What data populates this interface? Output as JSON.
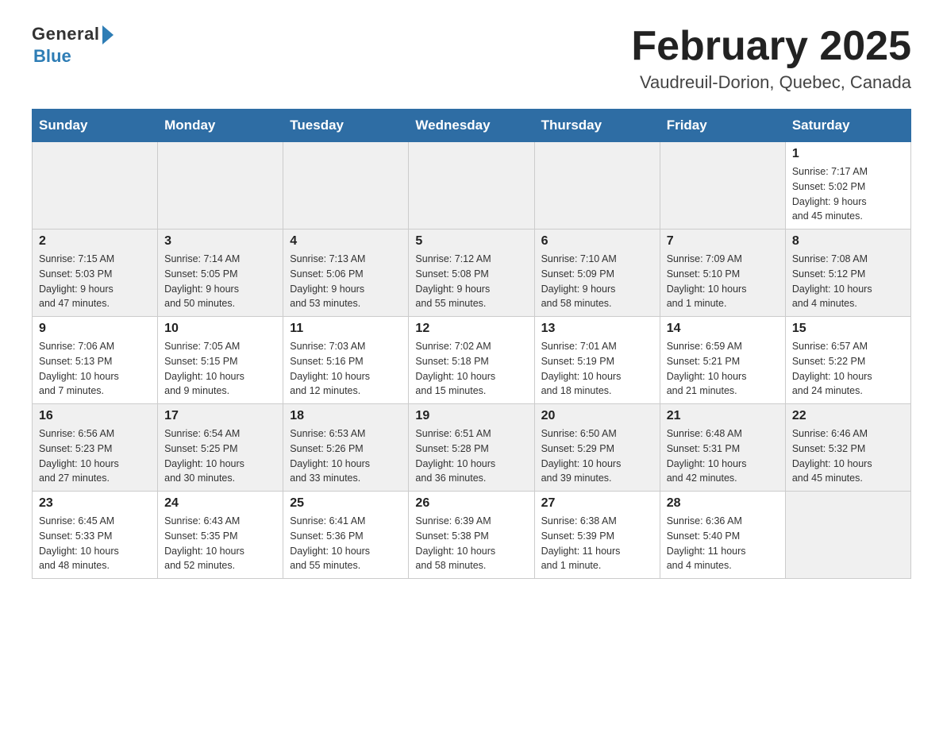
{
  "header": {
    "logo_general": "General",
    "logo_blue": "Blue",
    "page_title": "February 2025",
    "subtitle": "Vaudreuil-Dorion, Quebec, Canada"
  },
  "weekdays": [
    "Sunday",
    "Monday",
    "Tuesday",
    "Wednesday",
    "Thursday",
    "Friday",
    "Saturday"
  ],
  "weeks": [
    [
      {
        "day": "",
        "info": ""
      },
      {
        "day": "",
        "info": ""
      },
      {
        "day": "",
        "info": ""
      },
      {
        "day": "",
        "info": ""
      },
      {
        "day": "",
        "info": ""
      },
      {
        "day": "",
        "info": ""
      },
      {
        "day": "1",
        "info": "Sunrise: 7:17 AM\nSunset: 5:02 PM\nDaylight: 9 hours\nand 45 minutes."
      }
    ],
    [
      {
        "day": "2",
        "info": "Sunrise: 7:15 AM\nSunset: 5:03 PM\nDaylight: 9 hours\nand 47 minutes."
      },
      {
        "day": "3",
        "info": "Sunrise: 7:14 AM\nSunset: 5:05 PM\nDaylight: 9 hours\nand 50 minutes."
      },
      {
        "day": "4",
        "info": "Sunrise: 7:13 AM\nSunset: 5:06 PM\nDaylight: 9 hours\nand 53 minutes."
      },
      {
        "day": "5",
        "info": "Sunrise: 7:12 AM\nSunset: 5:08 PM\nDaylight: 9 hours\nand 55 minutes."
      },
      {
        "day": "6",
        "info": "Sunrise: 7:10 AM\nSunset: 5:09 PM\nDaylight: 9 hours\nand 58 minutes."
      },
      {
        "day": "7",
        "info": "Sunrise: 7:09 AM\nSunset: 5:10 PM\nDaylight: 10 hours\nand 1 minute."
      },
      {
        "day": "8",
        "info": "Sunrise: 7:08 AM\nSunset: 5:12 PM\nDaylight: 10 hours\nand 4 minutes."
      }
    ],
    [
      {
        "day": "9",
        "info": "Sunrise: 7:06 AM\nSunset: 5:13 PM\nDaylight: 10 hours\nand 7 minutes."
      },
      {
        "day": "10",
        "info": "Sunrise: 7:05 AM\nSunset: 5:15 PM\nDaylight: 10 hours\nand 9 minutes."
      },
      {
        "day": "11",
        "info": "Sunrise: 7:03 AM\nSunset: 5:16 PM\nDaylight: 10 hours\nand 12 minutes."
      },
      {
        "day": "12",
        "info": "Sunrise: 7:02 AM\nSunset: 5:18 PM\nDaylight: 10 hours\nand 15 minutes."
      },
      {
        "day": "13",
        "info": "Sunrise: 7:01 AM\nSunset: 5:19 PM\nDaylight: 10 hours\nand 18 minutes."
      },
      {
        "day": "14",
        "info": "Sunrise: 6:59 AM\nSunset: 5:21 PM\nDaylight: 10 hours\nand 21 minutes."
      },
      {
        "day": "15",
        "info": "Sunrise: 6:57 AM\nSunset: 5:22 PM\nDaylight: 10 hours\nand 24 minutes."
      }
    ],
    [
      {
        "day": "16",
        "info": "Sunrise: 6:56 AM\nSunset: 5:23 PM\nDaylight: 10 hours\nand 27 minutes."
      },
      {
        "day": "17",
        "info": "Sunrise: 6:54 AM\nSunset: 5:25 PM\nDaylight: 10 hours\nand 30 minutes."
      },
      {
        "day": "18",
        "info": "Sunrise: 6:53 AM\nSunset: 5:26 PM\nDaylight: 10 hours\nand 33 minutes."
      },
      {
        "day": "19",
        "info": "Sunrise: 6:51 AM\nSunset: 5:28 PM\nDaylight: 10 hours\nand 36 minutes."
      },
      {
        "day": "20",
        "info": "Sunrise: 6:50 AM\nSunset: 5:29 PM\nDaylight: 10 hours\nand 39 minutes."
      },
      {
        "day": "21",
        "info": "Sunrise: 6:48 AM\nSunset: 5:31 PM\nDaylight: 10 hours\nand 42 minutes."
      },
      {
        "day": "22",
        "info": "Sunrise: 6:46 AM\nSunset: 5:32 PM\nDaylight: 10 hours\nand 45 minutes."
      }
    ],
    [
      {
        "day": "23",
        "info": "Sunrise: 6:45 AM\nSunset: 5:33 PM\nDaylight: 10 hours\nand 48 minutes."
      },
      {
        "day": "24",
        "info": "Sunrise: 6:43 AM\nSunset: 5:35 PM\nDaylight: 10 hours\nand 52 minutes."
      },
      {
        "day": "25",
        "info": "Sunrise: 6:41 AM\nSunset: 5:36 PM\nDaylight: 10 hours\nand 55 minutes."
      },
      {
        "day": "26",
        "info": "Sunrise: 6:39 AM\nSunset: 5:38 PM\nDaylight: 10 hours\nand 58 minutes."
      },
      {
        "day": "27",
        "info": "Sunrise: 6:38 AM\nSunset: 5:39 PM\nDaylight: 11 hours\nand 1 minute."
      },
      {
        "day": "28",
        "info": "Sunrise: 6:36 AM\nSunset: 5:40 PM\nDaylight: 11 hours\nand 4 minutes."
      },
      {
        "day": "",
        "info": ""
      }
    ]
  ]
}
